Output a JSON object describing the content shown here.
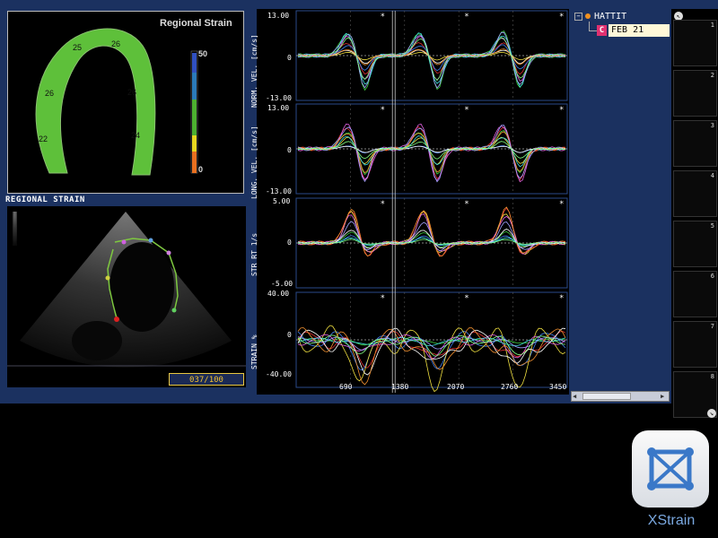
{
  "regional_strain": {
    "title": "Regional Strain",
    "segments": [
      "25",
      "26",
      "26",
      "26",
      "22",
      "24"
    ],
    "colorbar": {
      "max_label": "50",
      "min_label": "0"
    },
    "panel_label": "REGIONAL STRAIN"
  },
  "echo": {
    "frame_counter": "037/100"
  },
  "graphs": {
    "panels": [
      {
        "ylabel": "NORM. VEL. [cm/s]",
        "ymax": "13.00",
        "zero": "0",
        "ymin": "-13.00"
      },
      {
        "ylabel": "LONG. VEL. [cm/s]",
        "ymax": "13.00",
        "zero": "0",
        "ymin": "-13.00"
      },
      {
        "ylabel": "STR RT 1/s",
        "ymax": "5.00",
        "zero": "0",
        "ymin": "-5.00"
      },
      {
        "ylabel": "STRAIN %",
        "ymax": "40.00",
        "zero": "0",
        "ymin": "-40.00"
      }
    ],
    "x_ticks": [
      "690",
      "1380",
      "2070",
      "2760",
      "3450"
    ],
    "marker": "*"
  },
  "tree": {
    "patient": "HATTIT",
    "study_badge": "C",
    "study_date": "FEB 21"
  },
  "thumbnails": [
    "1",
    "2",
    "3",
    "4",
    "5",
    "6",
    "7",
    "8"
  ],
  "logo": {
    "text": "XStrain"
  },
  "colors": {
    "app_bg": "#1b3160",
    "strain_green": "#5ec03a",
    "accent_yellow": "#f0c030"
  }
}
